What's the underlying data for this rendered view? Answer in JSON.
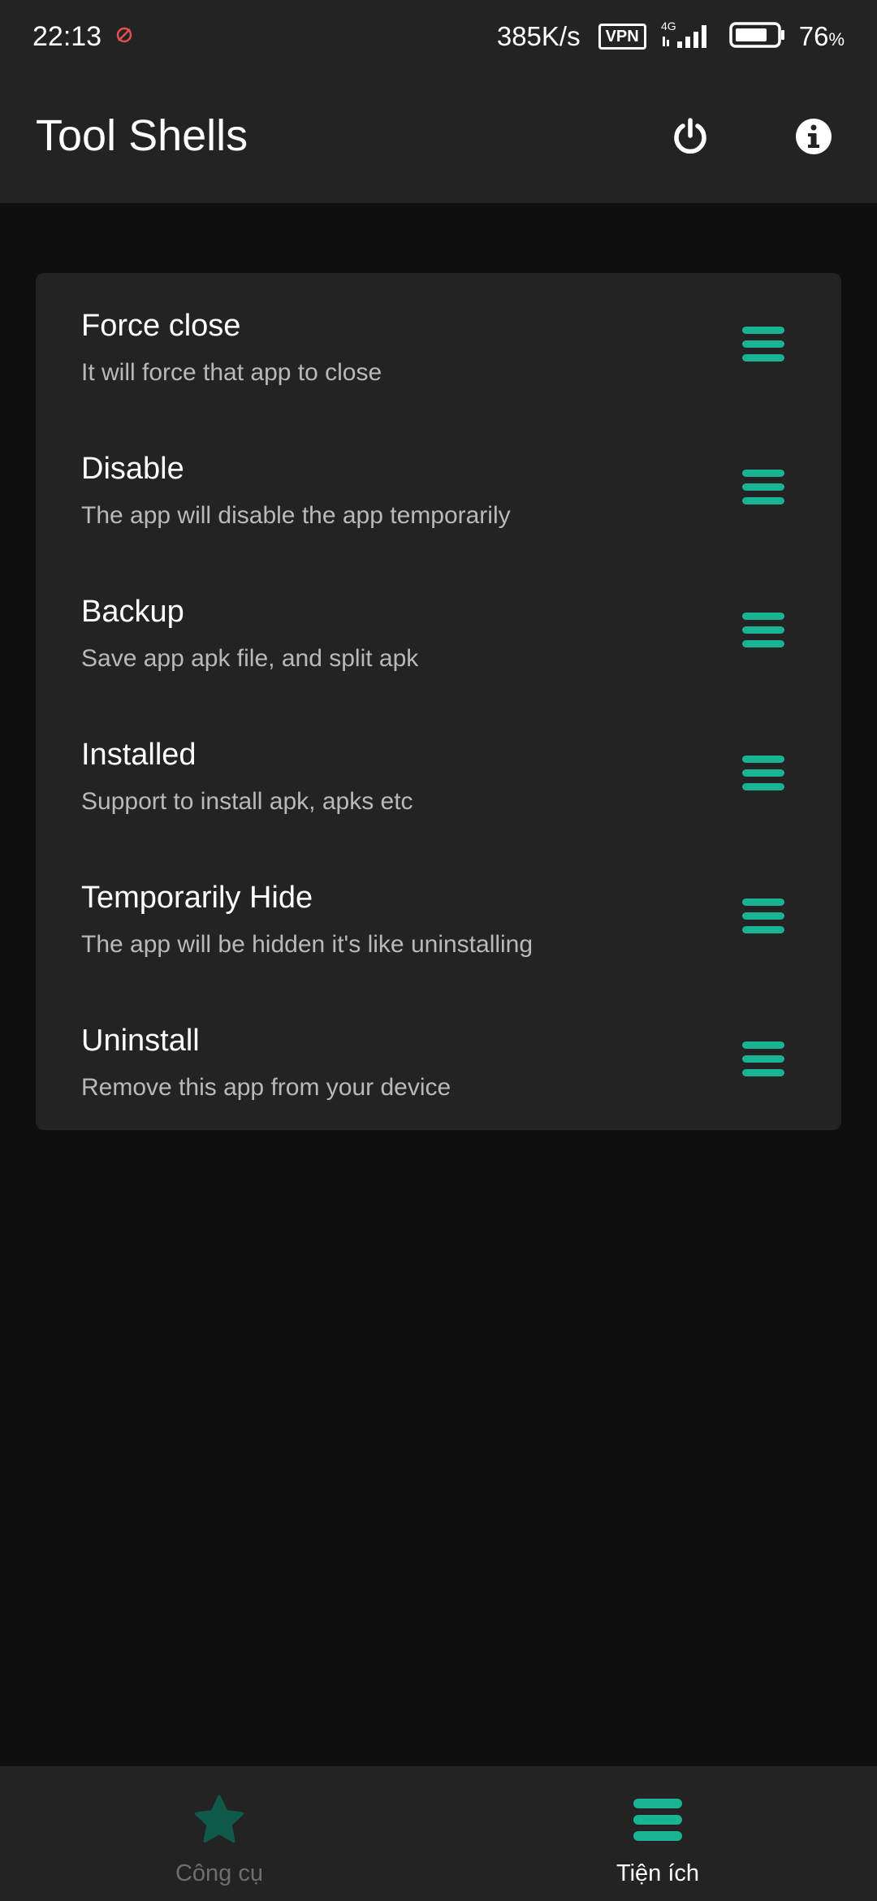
{
  "status_bar": {
    "time": "22:13",
    "net_speed": "385K/s",
    "vpn": "VPN",
    "network_type": "4G",
    "battery_level": "76",
    "battery_unit": "%"
  },
  "app_bar": {
    "title": "Tool Shells",
    "icons": [
      "power-icon",
      "info-icon"
    ]
  },
  "accent_color": "#1ab394",
  "tools": [
    {
      "title": "Force close",
      "subtitle": "It will force that app to close",
      "icon": "menu-icon"
    },
    {
      "title": "Disable",
      "subtitle": "The app will disable the app temporarily",
      "icon": "menu-icon"
    },
    {
      "title": "Backup",
      "subtitle": "Save app apk file, and split apk",
      "icon": "menu-icon"
    },
    {
      "title": "Installed",
      "subtitle": "Support to install apk, apks etc",
      "icon": "menu-icon"
    },
    {
      "title": "Temporarily Hide",
      "subtitle": "The app will be hidden it's like uninstalling",
      "icon": "menu-icon"
    },
    {
      "title": "Uninstall",
      "subtitle": "Remove this app from your device",
      "icon": "menu-icon"
    }
  ],
  "bottom_nav": {
    "items": [
      {
        "label": "Công cụ",
        "icon": "star-icon",
        "active": false
      },
      {
        "label": "Tiện ích",
        "icon": "menu-icon",
        "active": true
      }
    ]
  }
}
